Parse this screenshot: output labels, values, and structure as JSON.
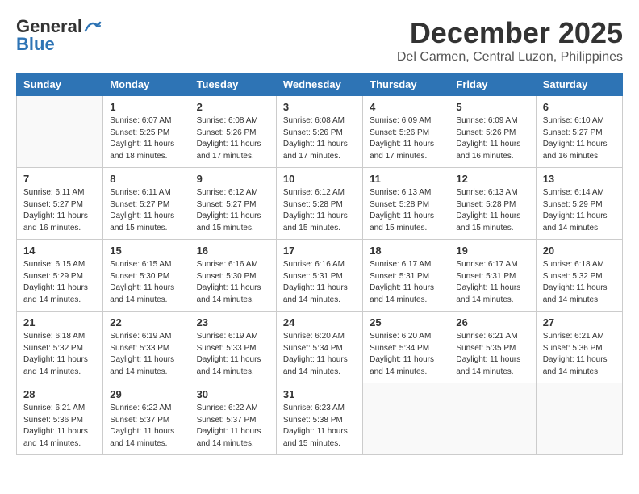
{
  "header": {
    "logo_line1": "General",
    "logo_line2": "Blue",
    "title": "December 2025",
    "subtitle": "Del Carmen, Central Luzon, Philippines"
  },
  "calendar": {
    "days_of_week": [
      "Sunday",
      "Monday",
      "Tuesday",
      "Wednesday",
      "Thursday",
      "Friday",
      "Saturday"
    ],
    "weeks": [
      [
        {
          "day": "",
          "sunrise": "",
          "sunset": "",
          "daylight": ""
        },
        {
          "day": "1",
          "sunrise": "6:07 AM",
          "sunset": "5:25 PM",
          "daylight": "11 hours and 18 minutes."
        },
        {
          "day": "2",
          "sunrise": "6:08 AM",
          "sunset": "5:26 PM",
          "daylight": "11 hours and 17 minutes."
        },
        {
          "day": "3",
          "sunrise": "6:08 AM",
          "sunset": "5:26 PM",
          "daylight": "11 hours and 17 minutes."
        },
        {
          "day": "4",
          "sunrise": "6:09 AM",
          "sunset": "5:26 PM",
          "daylight": "11 hours and 17 minutes."
        },
        {
          "day": "5",
          "sunrise": "6:09 AM",
          "sunset": "5:26 PM",
          "daylight": "11 hours and 16 minutes."
        },
        {
          "day": "6",
          "sunrise": "6:10 AM",
          "sunset": "5:27 PM",
          "daylight": "11 hours and 16 minutes."
        }
      ],
      [
        {
          "day": "7",
          "sunrise": "6:11 AM",
          "sunset": "5:27 PM",
          "daylight": "11 hours and 16 minutes."
        },
        {
          "day": "8",
          "sunrise": "6:11 AM",
          "sunset": "5:27 PM",
          "daylight": "11 hours and 15 minutes."
        },
        {
          "day": "9",
          "sunrise": "6:12 AM",
          "sunset": "5:27 PM",
          "daylight": "11 hours and 15 minutes."
        },
        {
          "day": "10",
          "sunrise": "6:12 AM",
          "sunset": "5:28 PM",
          "daylight": "11 hours and 15 minutes."
        },
        {
          "day": "11",
          "sunrise": "6:13 AM",
          "sunset": "5:28 PM",
          "daylight": "11 hours and 15 minutes."
        },
        {
          "day": "12",
          "sunrise": "6:13 AM",
          "sunset": "5:28 PM",
          "daylight": "11 hours and 15 minutes."
        },
        {
          "day": "13",
          "sunrise": "6:14 AM",
          "sunset": "5:29 PM",
          "daylight": "11 hours and 14 minutes."
        }
      ],
      [
        {
          "day": "14",
          "sunrise": "6:15 AM",
          "sunset": "5:29 PM",
          "daylight": "11 hours and 14 minutes."
        },
        {
          "day": "15",
          "sunrise": "6:15 AM",
          "sunset": "5:30 PM",
          "daylight": "11 hours and 14 minutes."
        },
        {
          "day": "16",
          "sunrise": "6:16 AM",
          "sunset": "5:30 PM",
          "daylight": "11 hours and 14 minutes."
        },
        {
          "day": "17",
          "sunrise": "6:16 AM",
          "sunset": "5:31 PM",
          "daylight": "11 hours and 14 minutes."
        },
        {
          "day": "18",
          "sunrise": "6:17 AM",
          "sunset": "5:31 PM",
          "daylight": "11 hours and 14 minutes."
        },
        {
          "day": "19",
          "sunrise": "6:17 AM",
          "sunset": "5:31 PM",
          "daylight": "11 hours and 14 minutes."
        },
        {
          "day": "20",
          "sunrise": "6:18 AM",
          "sunset": "5:32 PM",
          "daylight": "11 hours and 14 minutes."
        }
      ],
      [
        {
          "day": "21",
          "sunrise": "6:18 AM",
          "sunset": "5:32 PM",
          "daylight": "11 hours and 14 minutes."
        },
        {
          "day": "22",
          "sunrise": "6:19 AM",
          "sunset": "5:33 PM",
          "daylight": "11 hours and 14 minutes."
        },
        {
          "day": "23",
          "sunrise": "6:19 AM",
          "sunset": "5:33 PM",
          "daylight": "11 hours and 14 minutes."
        },
        {
          "day": "24",
          "sunrise": "6:20 AM",
          "sunset": "5:34 PM",
          "daylight": "11 hours and 14 minutes."
        },
        {
          "day": "25",
          "sunrise": "6:20 AM",
          "sunset": "5:34 PM",
          "daylight": "11 hours and 14 minutes."
        },
        {
          "day": "26",
          "sunrise": "6:21 AM",
          "sunset": "5:35 PM",
          "daylight": "11 hours and 14 minutes."
        },
        {
          "day": "27",
          "sunrise": "6:21 AM",
          "sunset": "5:36 PM",
          "daylight": "11 hours and 14 minutes."
        }
      ],
      [
        {
          "day": "28",
          "sunrise": "6:21 AM",
          "sunset": "5:36 PM",
          "daylight": "11 hours and 14 minutes."
        },
        {
          "day": "29",
          "sunrise": "6:22 AM",
          "sunset": "5:37 PM",
          "daylight": "11 hours and 14 minutes."
        },
        {
          "day": "30",
          "sunrise": "6:22 AM",
          "sunset": "5:37 PM",
          "daylight": "11 hours and 14 minutes."
        },
        {
          "day": "31",
          "sunrise": "6:23 AM",
          "sunset": "5:38 PM",
          "daylight": "11 hours and 15 minutes."
        },
        {
          "day": "",
          "sunrise": "",
          "sunset": "",
          "daylight": ""
        },
        {
          "day": "",
          "sunrise": "",
          "sunset": "",
          "daylight": ""
        },
        {
          "day": "",
          "sunrise": "",
          "sunset": "",
          "daylight": ""
        }
      ]
    ]
  }
}
